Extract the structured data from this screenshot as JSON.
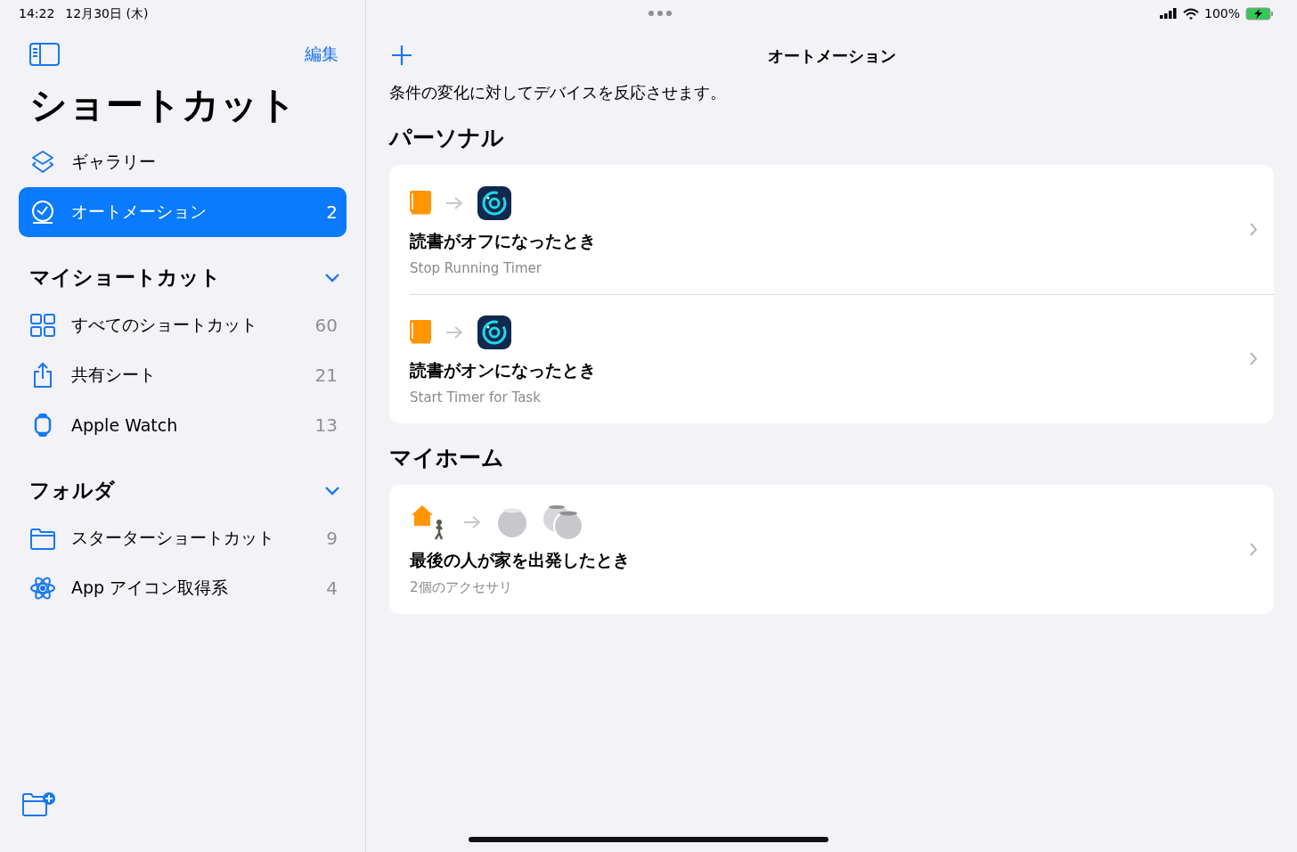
{
  "status_bar": {
    "time": "14:22",
    "date": "12月30日 (木)",
    "battery": "100%"
  },
  "sidebar": {
    "edit_label": "編集",
    "title": "ショートカット",
    "items": [
      {
        "kind": "gallery",
        "label": "ギャラリー",
        "selected": false
      },
      {
        "kind": "automation",
        "label": "オートメーション",
        "count": "2",
        "selected": true
      }
    ],
    "sections": [
      {
        "title": "マイショートカット",
        "expanded": true,
        "items": [
          {
            "kind": "grid",
            "label": "すべてのショートカット",
            "count": "60",
            "selected": false
          },
          {
            "kind": "share",
            "label": "共有シート",
            "count": "21",
            "selected": false
          },
          {
            "kind": "watch",
            "label": "Apple Watch",
            "count": "13",
            "selected": false
          }
        ]
      },
      {
        "title": "フォルダ",
        "expanded": true,
        "items": [
          {
            "kind": "folder",
            "label": "スターターショートカット",
            "count": "9",
            "selected": false
          },
          {
            "kind": "atom",
            "label": "App アイコン取得系",
            "count": "4",
            "selected": false
          }
        ]
      }
    ]
  },
  "main": {
    "title": "オートメーション",
    "description": "条件の変化に対してデバイスを反応させます。",
    "groups": [
      {
        "title": "パーソナル",
        "automations": [
          {
            "kind": "app",
            "title": "読書がオフになったとき",
            "subtitle": "Stop Running Timer"
          },
          {
            "kind": "app",
            "title": "読書がオンになったとき",
            "subtitle": "Start Timer for Task"
          }
        ]
      },
      {
        "title": "マイホーム",
        "automations": [
          {
            "kind": "home",
            "title": "最後の人が家を出発したとき",
            "subtitle": "2個のアクセサリ"
          }
        ]
      }
    ]
  }
}
